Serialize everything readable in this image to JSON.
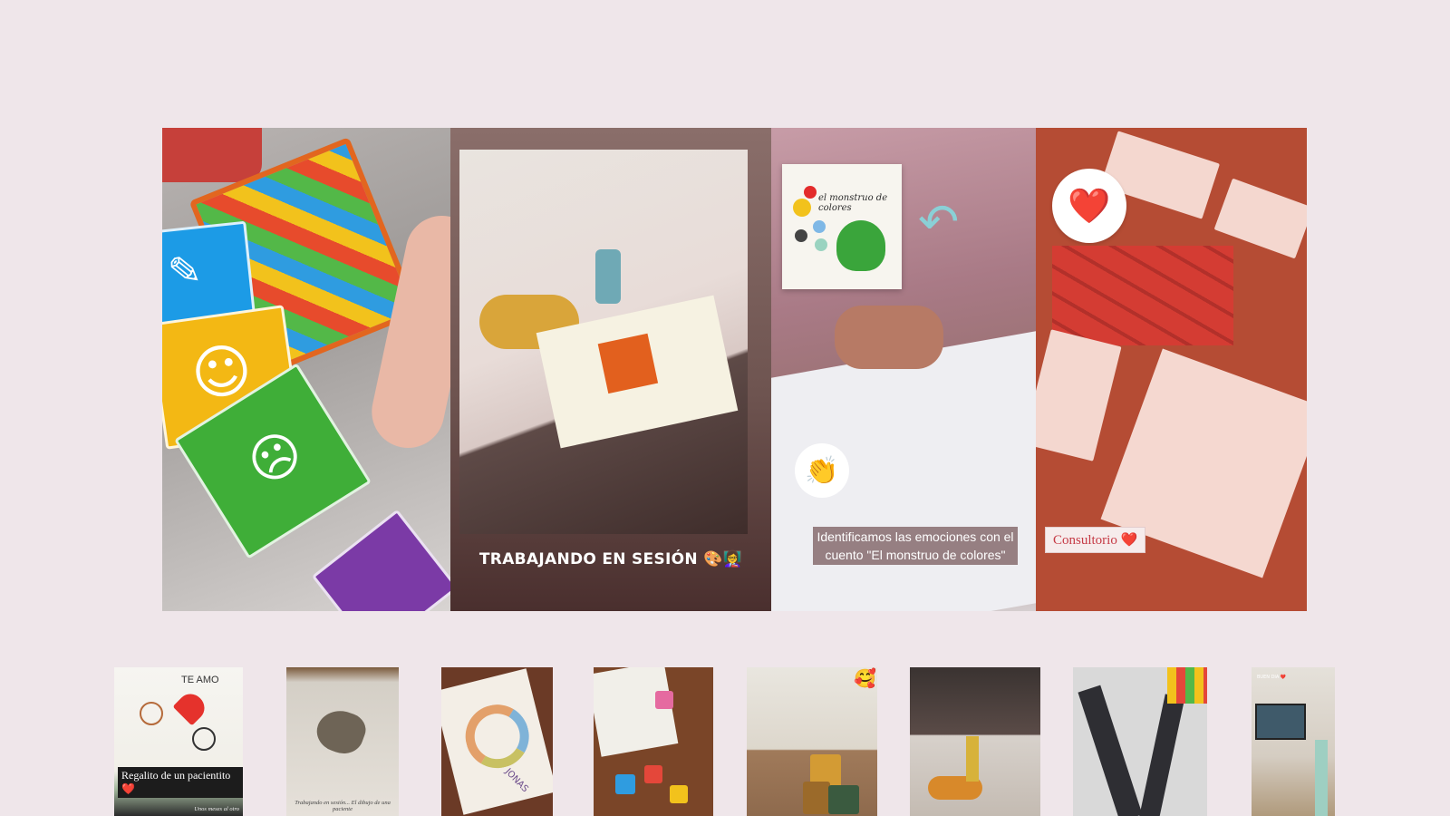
{
  "hero": {
    "panel2": {
      "caption": "TRABAJANDO EN SESIÓN 🎨👩‍🏫"
    },
    "panel3": {
      "book_title": "el monstruo de colores",
      "clap_emoji": "👏",
      "caption": "Identificamos las emociones con el cuento \"El monstruo de colores\""
    },
    "panel4": {
      "heart_emoji": "❤️",
      "caption": "Consultorio ❤️"
    }
  },
  "thumbnails": [
    {
      "top_text": "TE AMO",
      "overlay": "Regalito de un pacientito❤️",
      "subtext": "Unos meses al otro"
    },
    {
      "subtext": "Trabajando en sesión... El dibujo de una paciente"
    },
    {
      "text": "JONAS"
    },
    {},
    {},
    {},
    {},
    {
      "top_text": "BUEN DIA ❤️"
    }
  ]
}
